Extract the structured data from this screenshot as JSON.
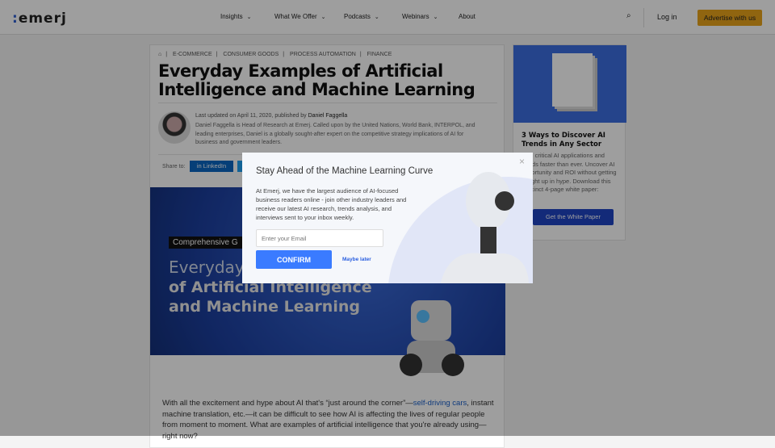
{
  "header": {
    "logo": "emerj",
    "nav": [
      "Insights",
      "What We Offer",
      "Podcasts",
      "Webinars",
      "About"
    ],
    "login": "Log in",
    "advertise": "Advertise with us"
  },
  "article": {
    "breadcrumbs": [
      "E-COMMERCE",
      "CONSUMER GOODS",
      "PROCESS AUTOMATION",
      "FINANCE"
    ],
    "title": "Everyday Examples of Artificial Intelligence and Machine Learning",
    "meta_prefix": "Last updated on April 11, 2020, published by ",
    "author": "Daniel Faggella",
    "bio": "Daniel Faggella is Head of Research at Emerj. Called upon by the United Nations, World Bank, INTERPOL, and leading enterprises, Daniel is a globally sought-after expert on the competitive strategy implications of AI for business and government leaders.",
    "share_label": "Share to:",
    "linkedin": "LinkedIn",
    "hero_tag": "Comprehensive G",
    "hero_line1": "Everyday",
    "hero_line2": "of Artificial Intelligence\nand Machine Learning",
    "body_1": "With all the excitement and hype about AI that's “just around the corner”—",
    "body_link": "self-driving cars",
    "body_2": ", instant machine translation, etc.—it can be difficult to see how AI is affecting the lives of regular people from moment to moment. What are examples of artificial intelligence that you're already using—right now?"
  },
  "sidebar": {
    "title": "3 Ways to Discover AI Trends in Any Sector",
    "text": "Find critical AI applications and trends faster than ever. Uncover AI opportunity and ROI without getting caught up in hype. Download this succinct 4-page white paper:",
    "button": "Get the White Paper"
  },
  "modal": {
    "title": "Stay Ahead of the Machine Learning Curve",
    "text": "At Emerj, we have the largest audience of AI-focused business readers online - join other industry leaders and receive our latest AI research, trends analysis, and interviews sent to your inbox weekly.",
    "email_placeholder": "Enter your Email",
    "confirm": "CONFIRM",
    "later": "Maybe later",
    "close": "×"
  }
}
